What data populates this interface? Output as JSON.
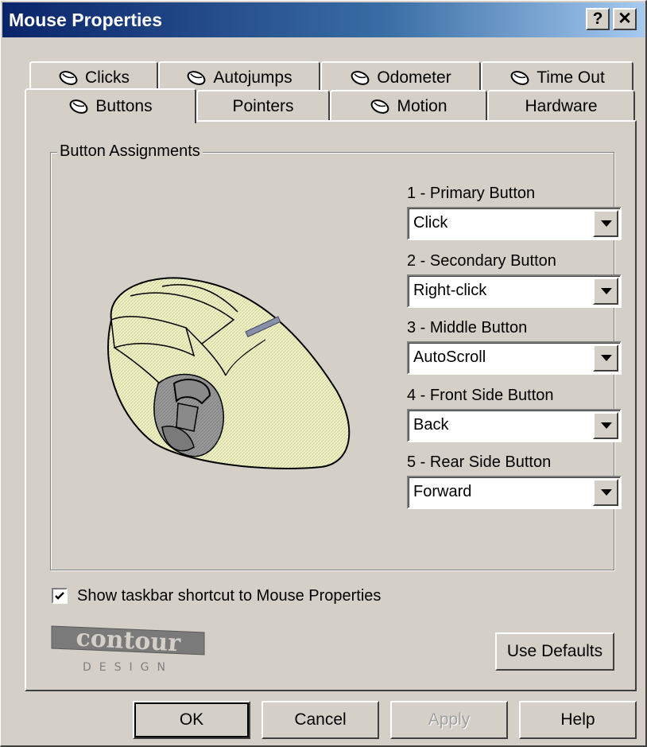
{
  "window": {
    "title": "Mouse Properties",
    "help_btn": "?",
    "close_btn": "✕"
  },
  "tabs": {
    "row_back": [
      {
        "label": "Clicks",
        "icon": "mouse-icon"
      },
      {
        "label": "Autojumps",
        "icon": "mouse-icon"
      },
      {
        "label": "Odometer",
        "icon": "mouse-icon"
      },
      {
        "label": "Time Out",
        "icon": "mouse-icon"
      }
    ],
    "row_front": [
      {
        "label": "Buttons",
        "icon": "mouse-icon",
        "active": true
      },
      {
        "label": "Pointers"
      },
      {
        "label": "Motion",
        "icon": "mouse-icon"
      },
      {
        "label": "Hardware"
      }
    ]
  },
  "group": {
    "title": "Button Assignments",
    "fields": [
      {
        "label": "1 - Primary Button",
        "value": "Click"
      },
      {
        "label": "2 - Secondary Button",
        "value": "Right-click"
      },
      {
        "label": "3 - Middle Button",
        "value": "AutoScroll"
      },
      {
        "label": "4 - Front Side Button",
        "value": "Back"
      },
      {
        "label": "5 - Rear Side Button",
        "value": "Forward"
      }
    ]
  },
  "options": {
    "taskbar_shortcut_label": "Show taskbar shortcut to Mouse Properties",
    "taskbar_shortcut_checked": true
  },
  "logo": {
    "brand": "contour",
    "sub": "DESIGN"
  },
  "buttons": {
    "use_defaults": "Use Defaults",
    "ok": "OK",
    "cancel": "Cancel",
    "apply": "Apply",
    "help": "Help"
  },
  "colors": {
    "title_start": "#0a246a",
    "title_end": "#a6caf0",
    "face": "#d4d0c8",
    "mouse_body": "#e8ecb0"
  }
}
